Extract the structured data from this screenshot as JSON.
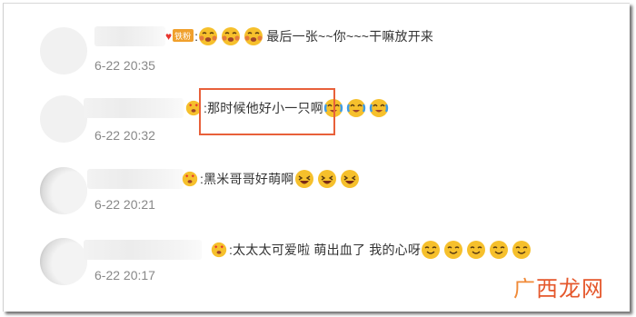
{
  "comments": [
    {
      "badge_label": "铁粉",
      "separator": ":",
      "text": "最后一张~~你~~~干嘛放开来",
      "time": "6-22 20:35",
      "emojis": [
        "hug-face",
        "hug-face",
        "hug-face"
      ]
    },
    {
      "separator": ":",
      "text": "那时候他好小一只啊",
      "time": "6-22 20:32",
      "emojis": [
        "tears-joy-face",
        "tears-joy-face",
        "tears-joy-face"
      ]
    },
    {
      "separator": ":",
      "text": "黑米哥哥好萌啊",
      "time": "6-22 20:21",
      "emojis": [
        "laughing-face",
        "laughing-face",
        "laughing-face"
      ]
    },
    {
      "separator": ":",
      "text": "太太太可爱啦 萌出血了 我的心呀",
      "time": "6-22 20:17",
      "emojis": [
        "grin-face",
        "grin-face",
        "grin-face",
        "grin-face",
        "grin-face"
      ]
    }
  ],
  "watermark": {
    "lead": "广",
    "rest": "西龙网"
  },
  "colors": {
    "highlight_border": "#e8603a",
    "watermark": "#e5572b",
    "emoji_yellow": "#f6c02c",
    "badge": "#f0a02c"
  }
}
